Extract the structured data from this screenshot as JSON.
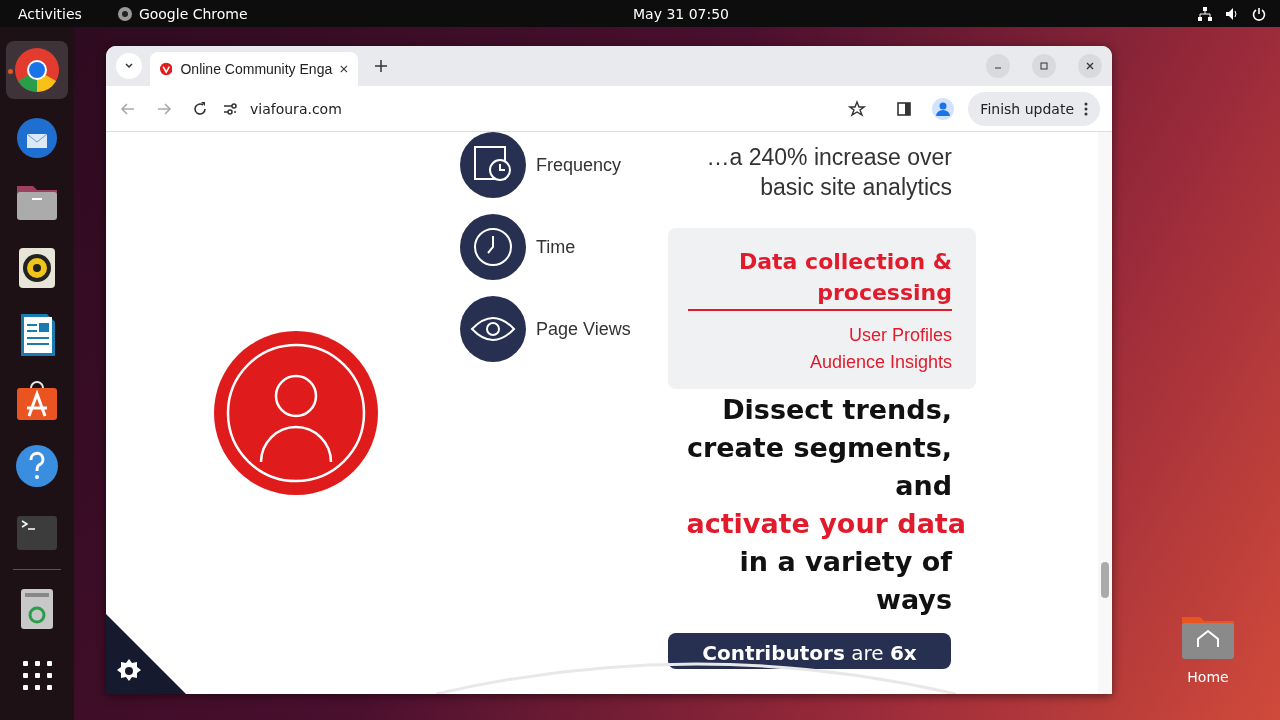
{
  "topbar": {
    "activities": "Activities",
    "app": "Google Chrome",
    "clock": "May 31  07:50"
  },
  "dock": [
    {
      "kind": "chrome",
      "running": true
    },
    {
      "kind": "mail",
      "running": false
    },
    {
      "kind": "files",
      "running": false
    },
    {
      "kind": "speaker",
      "running": false
    },
    {
      "kind": "writer",
      "running": false
    },
    {
      "kind": "store",
      "running": false
    },
    {
      "kind": "help",
      "running": false
    },
    {
      "kind": "terminal",
      "running": false
    },
    {
      "kind": "trash",
      "running": false
    },
    {
      "kind": "apps",
      "running": false
    }
  ],
  "browser": {
    "tab_title": "Online Community Enga",
    "url": "viafoura.com",
    "update_button": "Finish update"
  },
  "page": {
    "metrics": [
      {
        "kind": "calendar",
        "label": "Frequency"
      },
      {
        "kind": "clock",
        "label": "Time"
      },
      {
        "kind": "eye",
        "label": "Page Views"
      }
    ],
    "increase_text": "…a 240% increase over basic site analytics",
    "data_card": {
      "title": "Data collection & processing",
      "links": [
        "User Profiles",
        "Audience Insights"
      ]
    },
    "heading_before": "Dissect trends, create segments, and",
    "heading_highlight": "activate your data",
    "heading_after": "in a variety of ways",
    "contributors": {
      "bold": "Contributors",
      "plain": "are",
      "bold_end": "6x"
    }
  },
  "desktop": {
    "home_label": "Home"
  }
}
